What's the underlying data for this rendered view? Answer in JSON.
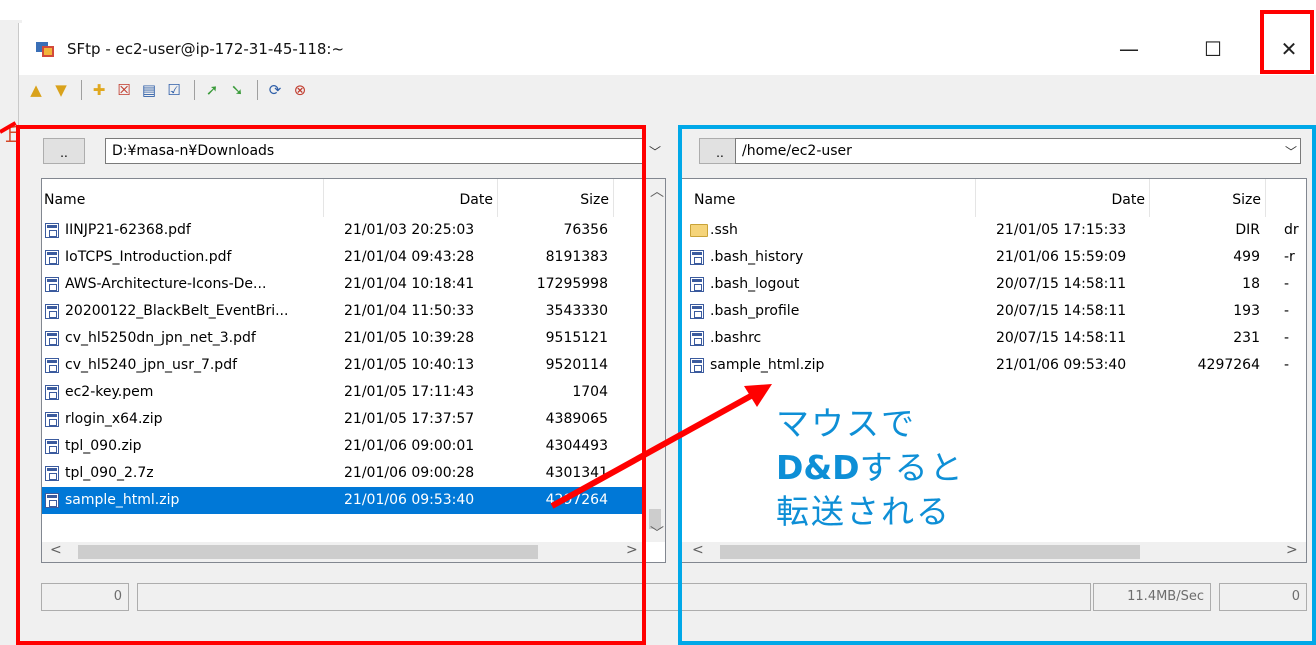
{
  "window": {
    "title": "SFtp - ec2-user@ip-172-31-45-118:~",
    "minimize_glyph": "—",
    "maximize_glyph": "☐",
    "close_glyph": "✕"
  },
  "toolbar": {
    "icons": [
      "folder-up-icon",
      "folder-down-icon",
      "new-folder-icon",
      "delete-icon",
      "properties-icon",
      "check-icon",
      "upload-icon",
      "download-icon",
      "refresh-icon",
      "stop-icon"
    ]
  },
  "local": {
    "up_label": "..",
    "path": "D:¥masa-n¥Downloads",
    "columns": {
      "name": "Name",
      "date": "Date",
      "size": "Size"
    },
    "files": [
      {
        "name": "IINJP21-62368.pdf",
        "date": "21/01/03 20:25:03",
        "size": "76356"
      },
      {
        "name": "IoTCPS_Introduction.pdf",
        "date": "21/01/04 09:43:28",
        "size": "8191383"
      },
      {
        "name": "AWS-Architecture-Icons-De...",
        "date": "21/01/04 10:18:41",
        "size": "17295998"
      },
      {
        "name": "20200122_BlackBelt_EventBri...",
        "date": "21/01/04 11:50:33",
        "size": "3543330"
      },
      {
        "name": "cv_hl5250dn_jpn_net_3.pdf",
        "date": "21/01/05 10:39:28",
        "size": "9515121"
      },
      {
        "name": "cv_hl5240_jpn_usr_7.pdf",
        "date": "21/01/05 10:40:13",
        "size": "9520114"
      },
      {
        "name": "ec2-key.pem",
        "date": "21/01/05 17:11:43",
        "size": "1704"
      },
      {
        "name": "rlogin_x64.zip",
        "date": "21/01/05 17:37:57",
        "size": "4389065"
      },
      {
        "name": "tpl_090.zip",
        "date": "21/01/06 09:00:01",
        "size": "4304493"
      },
      {
        "name": "tpl_090_2.7z",
        "date": "21/01/06 09:00:28",
        "size": "4301341"
      },
      {
        "name": "sample_html.zip",
        "date": "21/01/06 09:53:40",
        "size": "4297264"
      }
    ]
  },
  "remote": {
    "up_label": "..",
    "path": "/home/ec2-user",
    "columns": {
      "name": "Name",
      "date": "Date",
      "size": "Size"
    },
    "files": [
      {
        "name": ".ssh",
        "date": "21/01/05 17:15:33",
        "size": "DIR",
        "extra": "dr",
        "type": "folder"
      },
      {
        "name": ".bash_history",
        "date": "21/01/06 15:59:09",
        "size": "499",
        "extra": "-r",
        "type": "file"
      },
      {
        "name": ".bash_logout",
        "date": "20/07/15 14:58:11",
        "size": "18",
        "extra": "-",
        "type": "file"
      },
      {
        "name": ".bash_profile",
        "date": "20/07/15 14:58:11",
        "size": "193",
        "extra": "-",
        "type": "file"
      },
      {
        "name": ".bashrc",
        "date": "20/07/15 14:58:11",
        "size": "231",
        "extra": "-",
        "type": "file"
      },
      {
        "name": "sample_html.zip",
        "date": "21/01/06 09:53:40",
        "size": "4297264",
        "extra": "-",
        "type": "file"
      }
    ]
  },
  "status": {
    "left_count": "0",
    "speed": "11.4MB/Sec",
    "right_count": "0"
  },
  "annotation": {
    "line1": "マウスで",
    "line2_bold": "D&D",
    "line2_rest": "すると",
    "line3": "転送される"
  },
  "colors": {
    "selection": "#0078d7",
    "highlight_red": "#ff0000",
    "highlight_blue": "#00a8e8",
    "annotation_text": "#0e8fd6"
  }
}
